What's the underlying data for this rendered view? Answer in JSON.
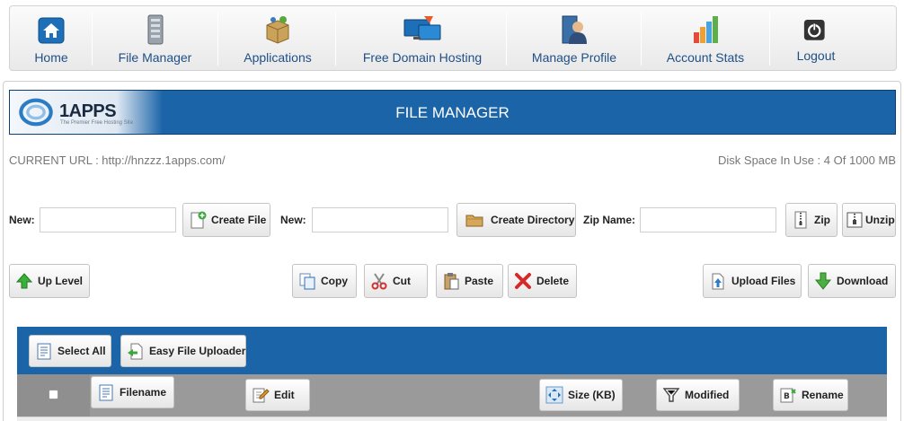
{
  "nav": {
    "home": "Home",
    "file_manager": "File Manager",
    "applications": "Applications",
    "free_domain_hosting": "Free Domain Hosting",
    "manage_profile": "Manage Profile",
    "account_stats": "Account Stats",
    "logout": "Logout"
  },
  "banner": {
    "logo_text": "1APPS",
    "logo_tagline": "The Premier Free Hosting Site",
    "title": "FILE MANAGER"
  },
  "info": {
    "current_url_label": "CURRENT URL : http://hnzzz.1apps.com/",
    "disk_space": "Disk Space In Use : 4 Of 1000 MB"
  },
  "toolbar1": {
    "new_label_1": "New:",
    "new_file_value": "",
    "create_file": "Create File",
    "new_label_2": "New:",
    "new_dir_value": "",
    "create_directory": "Create Directory",
    "zip_name_label": "Zip Name:",
    "zip_name_value": "",
    "zip": "Zip",
    "unzip": "Unzip"
  },
  "toolbar2": {
    "up_level": "Up Level",
    "copy": "Copy",
    "cut": "Cut",
    "paste": "Paste",
    "delete": "Delete",
    "upload_files": "Upload Files",
    "download": "Download"
  },
  "table": {
    "select_all": "Select All",
    "easy_file_uploader": "Easy File Uploader",
    "columns": {
      "filename": "Filename",
      "edit": "Edit",
      "size": "Size (KB)",
      "modified": "Modified",
      "rename": "Rename"
    }
  },
  "colors": {
    "brand_blue": "#1b64a8",
    "nav_text": "#1f4f86",
    "table_header_gray": "#9a9a9a"
  }
}
